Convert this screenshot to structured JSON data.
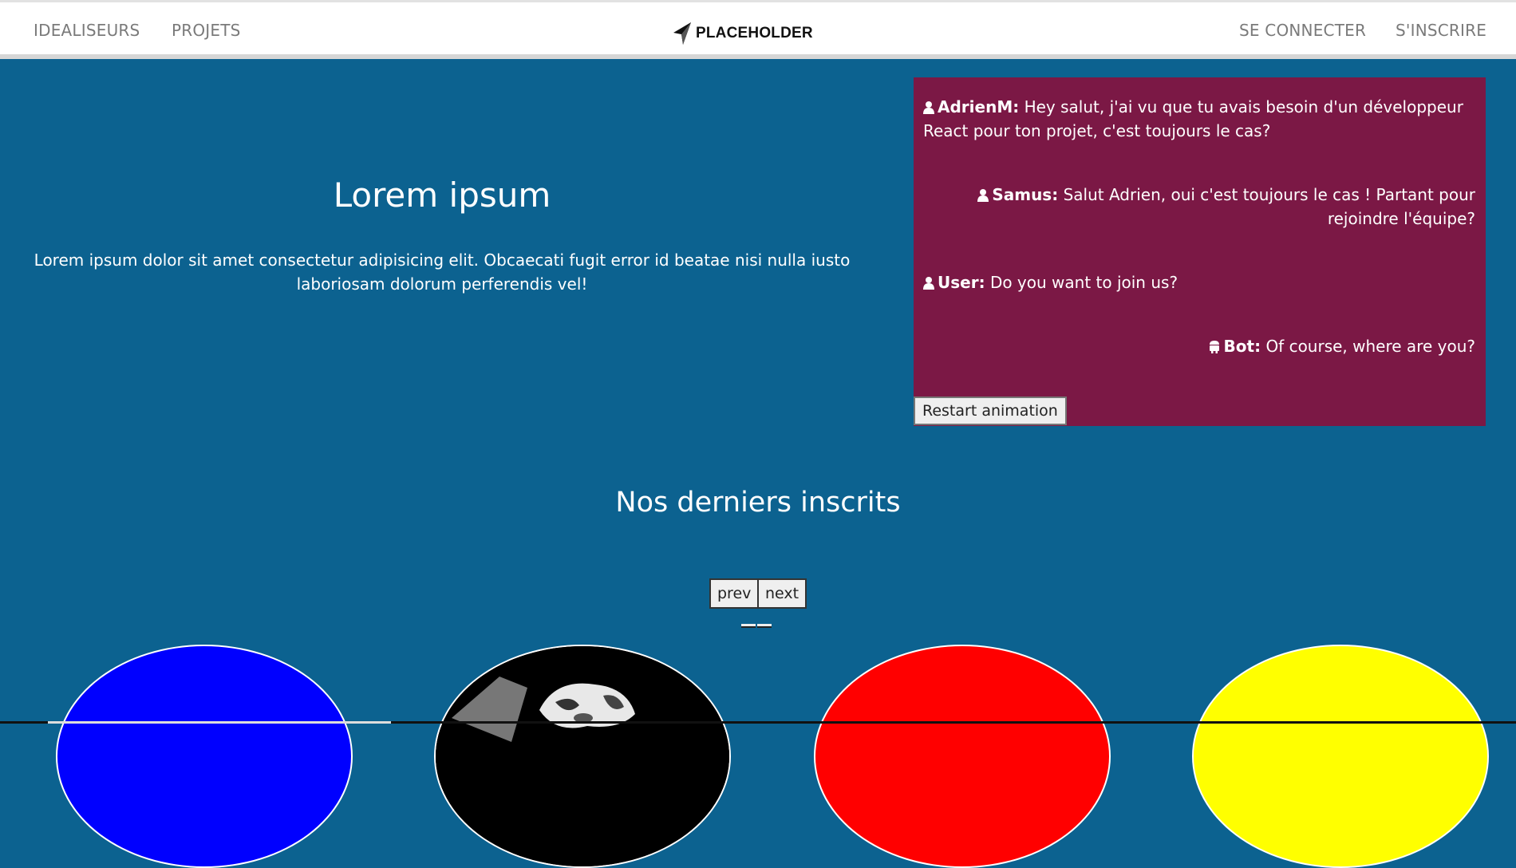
{
  "nav": {
    "left_links": [
      "IDEALISEURS",
      "PROJETS"
    ],
    "logo_text": "PLACEHOLDER",
    "right_links": [
      "SE CONNECTER",
      "S'INSCRIRE"
    ]
  },
  "hero": {
    "title": "Lorem ipsum",
    "text": "Lorem ipsum dolor sit amet consectetur adipisicing elit. Obcaecati fugit error id beatae nisi nulla iusto laboriosam dolorum perferendis vel!"
  },
  "chat": {
    "messages": [
      {
        "author": "AdrienM:",
        "text": "Hey salut, j'ai vu que tu avais besoin d'un développeur React pour ton projet, c'est toujours le cas?",
        "align": "left",
        "icon": "user-icon"
      },
      {
        "author": "Samus:",
        "text": "Salut Adrien, oui c'est toujours le cas ! Partant pour rejoindre l'équipe?",
        "align": "right",
        "icon": "user-icon"
      },
      {
        "author": "User:",
        "text": "Do you want to join us?",
        "align": "left",
        "icon": "user-icon"
      },
      {
        "author": "Bot:",
        "text": "Of course, where are you?",
        "align": "right",
        "icon": "android-icon"
      }
    ],
    "restart_label": "Restart animation",
    "background": "#7b1845"
  },
  "members": {
    "title": "Nos derniers inscrits",
    "prev_label": "prev",
    "next_label": "next",
    "avatar_colors": [
      "#0000ff",
      "#000000",
      "#ff0000",
      "#ffff00"
    ]
  },
  "colors": {
    "page_background": "#0c6290",
    "navbar_background": "#ffffff",
    "nav_text": "#7a7a7a"
  }
}
